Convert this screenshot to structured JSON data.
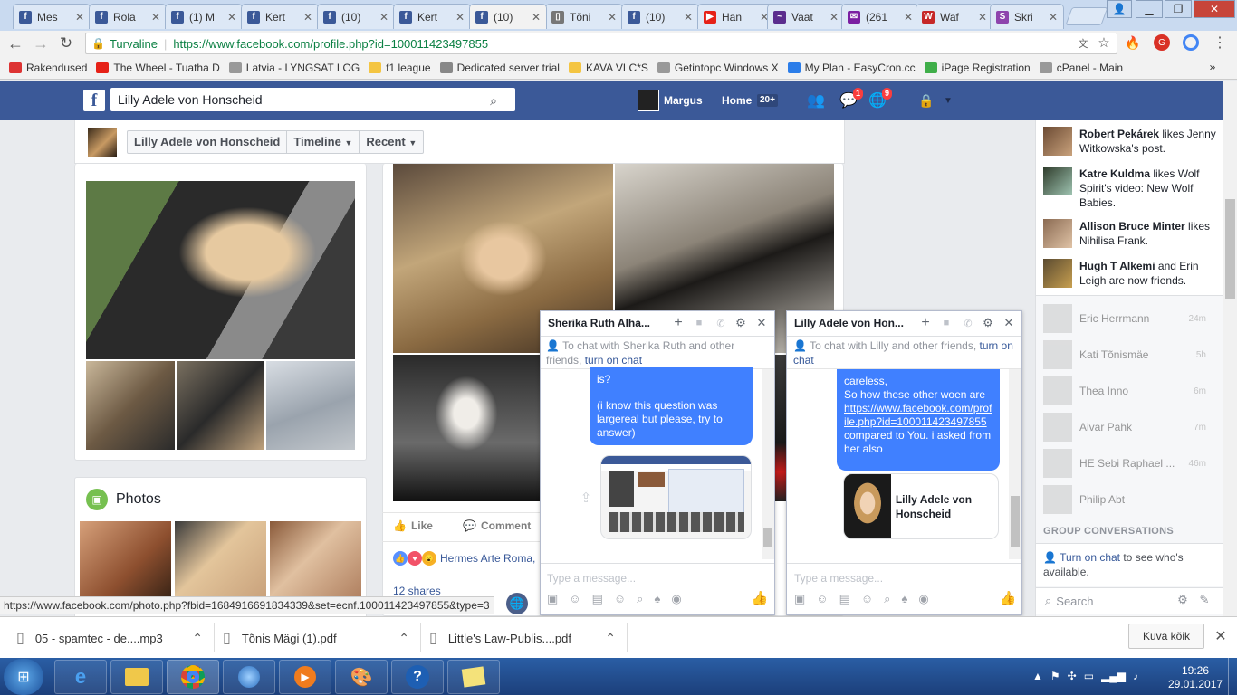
{
  "tabs": [
    {
      "title": "Mes",
      "color": "#3b5998",
      "glyph": "f"
    },
    {
      "title": "Rola",
      "color": "#3b5998",
      "glyph": "f"
    },
    {
      "title": "(1) M",
      "color": "#3b5998",
      "glyph": "f"
    },
    {
      "title": "Kert",
      "color": "#3b5998",
      "glyph": "f"
    },
    {
      "title": "(10)",
      "color": "#3b5998",
      "glyph": "f"
    },
    {
      "title": "Kert",
      "color": "#3b5998",
      "glyph": "f"
    },
    {
      "title": "(10)",
      "color": "#3b5998",
      "glyph": "f"
    },
    {
      "title": "Tõni",
      "color": "#777777",
      "glyph": "▯"
    },
    {
      "title": "(10)",
      "color": "#3b5998",
      "glyph": "f"
    },
    {
      "title": "Han",
      "color": "#e62117",
      "glyph": "▶"
    },
    {
      "title": "Vaat",
      "color": "#5b2d8e",
      "glyph": "~"
    },
    {
      "title": "(261",
      "color": "#7b1fa2",
      "glyph": "✉"
    },
    {
      "title": "Waf",
      "color": "#c62828",
      "glyph": "W"
    },
    {
      "title": "Skri",
      "color": "#8e44ad",
      "glyph": "S"
    }
  ],
  "address": {
    "secure_label": "Turvaline",
    "url": "https://www.facebook.com/profile.php?id=100011423497855"
  },
  "bookmarks": [
    {
      "label": "Rakendused",
      "color": "#d33"
    },
    {
      "label": "The Wheel - Tuatha D",
      "color": "#e62117"
    },
    {
      "label": "Latvia - LYNGSAT LOG",
      "color": "#999999"
    },
    {
      "label": "f1 league",
      "color": "#f4c542"
    },
    {
      "label": "Dedicated server trial",
      "color": "#888888"
    },
    {
      "label": "KAVA VLC*S",
      "color": "#f4c542"
    },
    {
      "label": "Getintopc Windows X",
      "color": "#999999"
    },
    {
      "label": "My Plan - EasyCron.cc",
      "color": "#2b7de9"
    },
    {
      "label": "iPage Registration",
      "color": "#3fae49"
    },
    {
      "label": "cPanel - Main",
      "color": "#999999"
    }
  ],
  "fb": {
    "search_value": "Lilly Adele von Honscheid",
    "user": "Margus",
    "home": "Home",
    "home_count": "20+",
    "messages_badge": "1",
    "notif_badge": "9"
  },
  "profile": {
    "name": "Lilly Adele von Honscheid",
    "timeline": "Timeline",
    "recent": "Recent",
    "photos_title": "Photos"
  },
  "post": {
    "like": "Like",
    "comment": "Comment",
    "shares": "12 shares",
    "reactors": "Hermes Arte Roma,"
  },
  "chat1": {
    "title": "Sherika Ruth Alha...",
    "notice_pre": "To chat with Sherika Ruth and other friends, ",
    "notice_link": "turn on chat",
    "bubble_lines": [
      "is?",
      "",
      "(i know this question was largereal but please, try to answer)"
    ],
    "placeholder": "Type a message..."
  },
  "chat2": {
    "title": "Lilly Adele von Hon...",
    "notice_pre": "To chat with Lilly and other friends, ",
    "notice_link": "turn on chat",
    "bubble_a": "careless,",
    "bubble_b": "So how these other woen are",
    "bubble_link": "https://www.facebook.com/profile.php?id=100011423497855",
    "bubble_c": "compared to You. i  asked from her also",
    "card_name": "Lilly Adele von Honscheid",
    "placeholder": "Type a message..."
  },
  "ticker": [
    {
      "actor": "Robert Pekárek",
      "text": " likes Jenny Witkowska's post."
    },
    {
      "actor": "Katre Kuldma",
      "text": " likes Wolf Spirit's video: New Wolf Babies."
    },
    {
      "actor": "Allison Bruce Minter",
      "text": " likes Nihilisa Frank."
    },
    {
      "actor": "Hugh T Alkemi",
      "text": " and Erin Leigh are now friends."
    }
  ],
  "contacts": [
    {
      "name": "Eric Herrmann",
      "time": "24m"
    },
    {
      "name": "Kati Tõnismäe",
      "time": "5h"
    },
    {
      "name": "Thea Inno",
      "time": "6m"
    },
    {
      "name": "Aivar Pahk",
      "time": "7m"
    },
    {
      "name": "HE Sebi Raphael ...",
      "time": "46m"
    },
    {
      "name": "Philip Abt",
      "time": ""
    }
  ],
  "sidebar": {
    "group_conv": "GROUP CONVERSATIONS",
    "turn_on_chat": "Turn on chat",
    "turn_on_rest": " to see who's available.",
    "search": "Search"
  },
  "status_url": "https://www.facebook.com/photo.php?fbid=1684916691834339&set=ecnf.100011423497855&type=3",
  "downloads": [
    {
      "name": "05 - spamtec - de....mp3"
    },
    {
      "name": "Tõnis Mägi (1).pdf"
    },
    {
      "name": "Little's Law-Publis....pdf"
    }
  ],
  "show_all": "Kuva kõik",
  "clock": {
    "time": "19:26",
    "date": "29.01.2017"
  }
}
